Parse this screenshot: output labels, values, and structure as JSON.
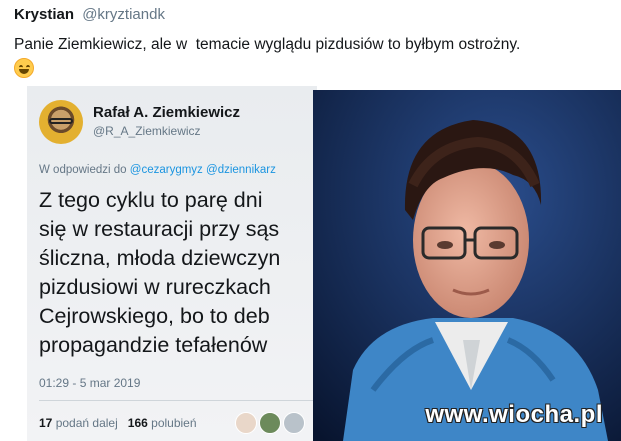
{
  "outer_tweet": {
    "name": "Krystian",
    "handle": "@kryztiandk",
    "text": "Panie Ziemkiewicz, ale w  temacie wyglądu pizdusiów to byłbym ostrożny."
  },
  "inner_tweet": {
    "name": "Rafał A. Ziemkiewicz",
    "handle": "@R_A_Ziemkiewicz",
    "reply_prefix": "W odpowiedzi do",
    "mention_1": "@cezarygmyz",
    "mention_2": "@dziennikarz",
    "lines": [
      "Z tego cyklu to parę dni",
      "się w restauracji przy sąs",
      "śliczna, młoda dziewczyn",
      "pizdusiowi w rureczkach",
      "Cejrowskiego, bo to deb",
      "propagandzie tefałenów"
    ],
    "timestamp": "01:29 - 5 mar 2019",
    "retweets": "17",
    "retweets_label": "podań dalej",
    "likes": "166",
    "likes_label": "polubień"
  },
  "photo": {
    "watermark": "www.wiocha.pl"
  },
  "icons": {
    "emoji": "grinning-face-icon"
  }
}
